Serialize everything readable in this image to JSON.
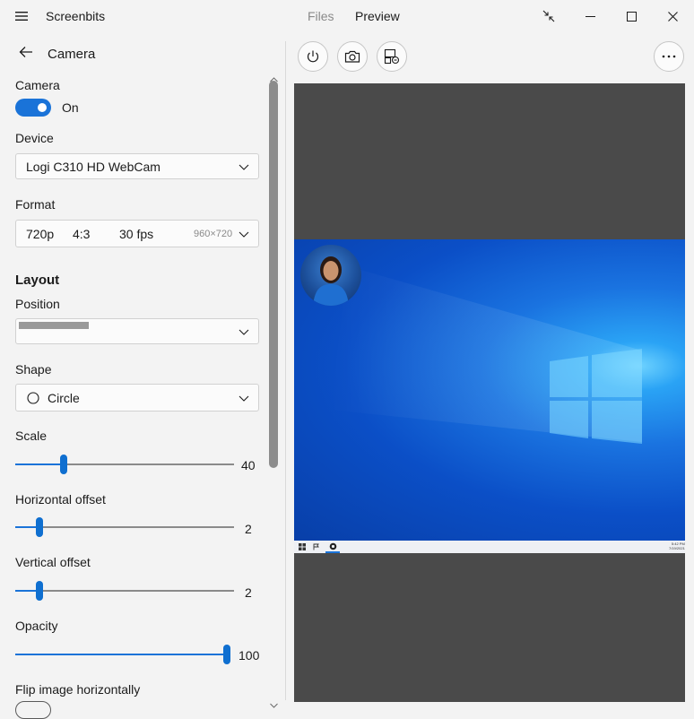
{
  "titlebar": {
    "app_name": "Screenbits",
    "tab_files": "Files",
    "tab_preview": "Preview"
  },
  "settings": {
    "page_title": "Camera",
    "camera_label": "Camera",
    "camera_toggle_state": "On",
    "device_label": "Device",
    "device_value": "Logi C310 HD WebCam",
    "format_label": "Format",
    "format_resolution": "720p",
    "format_aspect": "4:3",
    "format_fps": "30 fps",
    "format_dims": "960×720",
    "layout_heading": "Layout",
    "position_label": "Position",
    "shape_label": "Shape",
    "shape_value": "Circle",
    "scale_label": "Scale",
    "scale_value": "40",
    "scale_fraction": 0.22,
    "hoffset_label": "Horizontal offset",
    "hoffset_value": "2",
    "hoffset_fraction": 0.11,
    "voffset_label": "Vertical offset",
    "voffset_value": "2",
    "voffset_fraction": 0.11,
    "opacity_label": "Opacity",
    "opacity_value": "100",
    "opacity_fraction": 1.0,
    "flip_label": "Flip image horizontally"
  },
  "taskbar": {
    "time": "5:42 PM",
    "date": "7/19/2021"
  },
  "colors": {
    "accent": "#1a73d8",
    "preview_bg": "#4a4a4a"
  },
  "icons": [
    "hamburger-icon",
    "back-arrow-icon",
    "compact-overlay-icon",
    "minimize-icon",
    "maximize-icon",
    "close-icon",
    "power-icon",
    "camera-icon",
    "record-settings-icon",
    "more-icon",
    "chevron-down-icon",
    "circle-shape-icon"
  ]
}
